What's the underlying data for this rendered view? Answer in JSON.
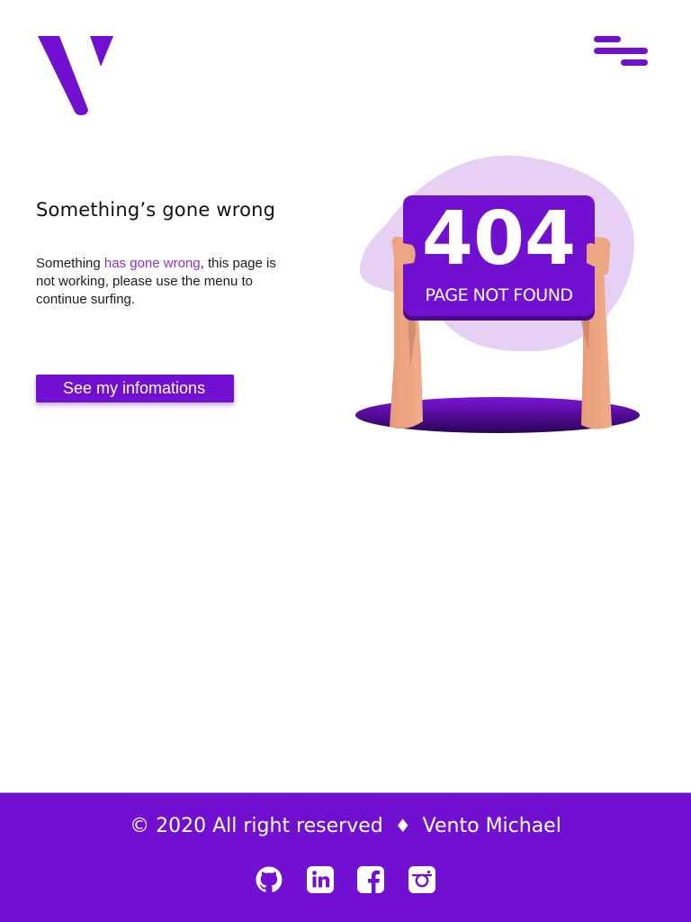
{
  "header": {
    "logo_icon": "v-logo-icon",
    "menu_icon": "hamburger-menu-icon"
  },
  "error": {
    "title": "Something’s gone wrong",
    "desc_prefix": "Something ",
    "desc_highlight": "has gone wrong",
    "desc_suffix": ",  this page is not working, please use the menu to continue surfing.",
    "button_label": "See my infomations"
  },
  "illustration": {
    "code": "404",
    "caption": "PAGE NOT FOUND"
  },
  "footer": {
    "copyright_left": "© 2020 All right reserved",
    "separator": "♦",
    "copyright_right": "Vento Michael",
    "socials": [
      {
        "icon": "github-icon"
      },
      {
        "icon": "linkedin-icon"
      },
      {
        "icon": "facebook-icon"
      },
      {
        "icon": "instagram-icon"
      }
    ]
  },
  "colors": {
    "accent": "#7110d1",
    "highlight_text": "#8a2fe0",
    "blob": "#e6d1f5",
    "skin": "#eda684",
    "footer_bg": "#7110d1"
  }
}
